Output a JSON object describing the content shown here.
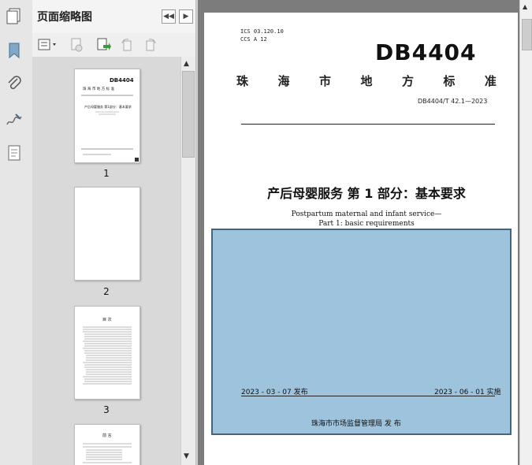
{
  "thumbnail_pane": {
    "title": "页面缩略图",
    "pages": [
      {
        "label": "1"
      },
      {
        "label": "2"
      },
      {
        "label": "3"
      },
      {
        "label": ""
      }
    ]
  },
  "document": {
    "ics_line1": "ICS  03.120.10",
    "ics_line2": "CCS  A  12",
    "logo": "DB4404",
    "standard_title": [
      "珠",
      "海",
      "市",
      "地",
      "方",
      "标",
      "准"
    ],
    "standard_number": "DB4404/T  42.1—2023",
    "main_title": "产后母婴服务  第 1 部分：基本要求",
    "english_title_line1": "Postpartum maternal and infant service—",
    "english_title_line2": "Part 1: basic requirements",
    "publish_date": "2023 - 03 - 07 发布",
    "effective_date": "2023 - 06 - 01 实施",
    "issuer": "珠海市市场监督管理局        发  布"
  },
  "colors": {
    "overlay_fill": "#9ec3dd",
    "overlay_border": "#48637a"
  }
}
